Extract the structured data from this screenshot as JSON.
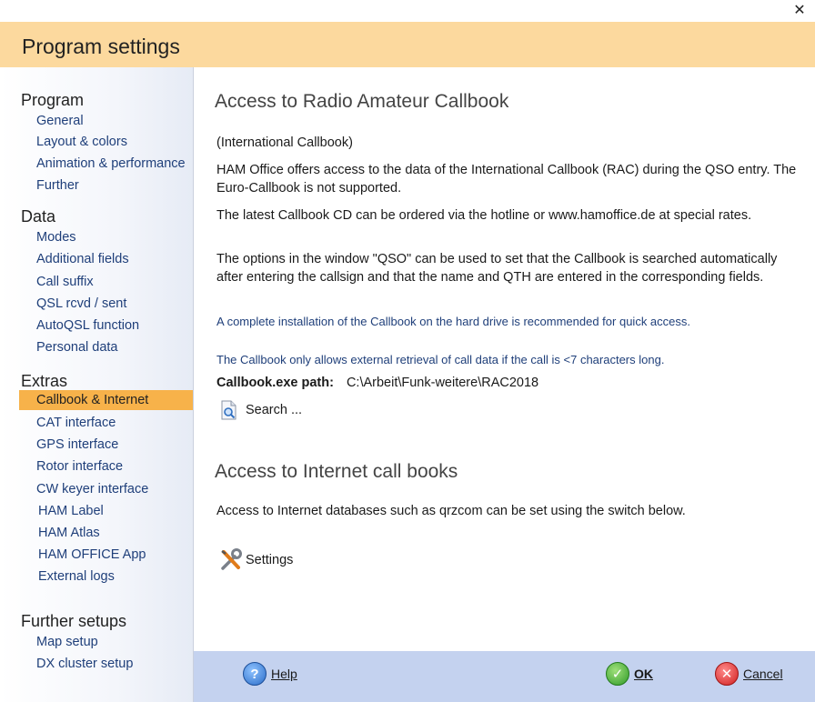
{
  "window": {
    "title": "Program settings",
    "close_glyph": "✕"
  },
  "sidebar": {
    "sections": [
      {
        "title": "Program",
        "items": [
          "General",
          "Layout & colors",
          "Animation & performance",
          "Further"
        ]
      },
      {
        "title": "Data",
        "items": [
          "Modes",
          "Additional fields",
          "Call suffix",
          "QSL rcvd / sent",
          "AutoQSL function",
          "Personal data"
        ]
      },
      {
        "title": "Extras",
        "items": [
          "Callbook & Internet",
          "CAT interface",
          "GPS interface",
          "Rotor interface",
          "CW keyer interface",
          "HAM Label",
          "HAM Atlas",
          "HAM OFFICE App",
          "External logs"
        ]
      },
      {
        "title": "Further setups",
        "items": [
          "Map setup",
          "DX cluster setup"
        ]
      }
    ],
    "selected": "Callbook & Internet"
  },
  "main": {
    "callbook_heading": "Access to Radio Amateur Callbook",
    "intl_label": "(International Callbook)",
    "para1": "HAM Office offers access to the data of the International Callbook (RAC) during the QSO entry. The Euro-Callbook is not supported.",
    "para2": "The latest Callbook CD can be ordered via the hotline or www.hamoffice.de at special rates.",
    "para3": "The options in the window \"QSO\" can be used to set that the Callbook is searched automatically after entering the callsign and that the name and QTH are entered in the corresponding fields.",
    "note1": "A complete installation of the Callbook on the hard drive is recommended for quick access.",
    "note2": "The Callbook only allows external retrieval of call data if the call is <7 characters long.",
    "path_label": "Callbook.exe path:",
    "path_value": "C:\\Arbeit\\Funk-weitere\\RAC2018",
    "search_label": "Search ...",
    "internet_heading": "Access to Internet call books",
    "internet_text": "Access to Internet databases such as qrzcom can be set using the switch below.",
    "settings_label": "Settings"
  },
  "footer": {
    "help": "Help",
    "ok": "OK",
    "cancel": "Cancel"
  },
  "colors": {
    "header_bg": "#fcd99e",
    "selection": "#f7b24a",
    "footer_bg": "#c4d2ef",
    "nav_text": "#1f3f7a"
  }
}
